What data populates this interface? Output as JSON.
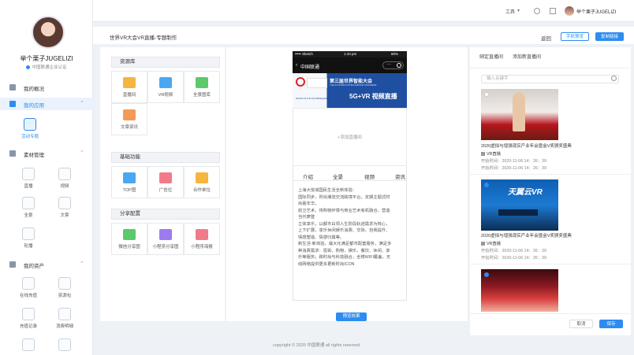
{
  "topbar": {
    "tools_label": "工具",
    "user_name": "举个栗子JUGELIZI"
  },
  "sidebar": {
    "user_name": "举个栗子JUGELIZI",
    "cert": "中国联通企业认证",
    "nav": [
      {
        "label": "我的概况"
      },
      {
        "label": "我的应用"
      },
      {
        "label": "素材管理"
      },
      {
        "label": "我的资产"
      }
    ],
    "app_items": [
      {
        "label": "活动专题"
      }
    ],
    "material_items": [
      {
        "label": "直播"
      },
      {
        "label": "视频"
      },
      {
        "label": "全景"
      },
      {
        "label": "文章"
      },
      {
        "label": "轮播"
      }
    ],
    "asset_items": [
      {
        "label": "在线充值"
      },
      {
        "label": "资源包"
      },
      {
        "label": "充值记录"
      },
      {
        "label": "消费明细"
      }
    ]
  },
  "header": {
    "title": "世界VR大会VR直播-专题制作",
    "back": "返回",
    "phone_preview": "手机预览",
    "copy_link": "复制链接"
  },
  "components": {
    "resource_title": "资源库",
    "resource_items": [
      {
        "label": "直播间"
      },
      {
        "label": "VR视频"
      },
      {
        "label": "全景图库"
      },
      {
        "label": "文章资讯"
      }
    ],
    "basic_title": "基础功能",
    "basic_items": [
      {
        "label": "TOP图"
      },
      {
        "label": "广告位"
      },
      {
        "label": "合作单位"
      }
    ],
    "share_title": "分享配置",
    "share_items": [
      {
        "label": "微信分享图"
      },
      {
        "label": "小程序分享图"
      },
      {
        "label": "小程序海报"
      }
    ]
  },
  "phone": {
    "status_left": "••••• Sketch",
    "status_time": "1:43 pm",
    "status_right": "80%",
    "nav_title": "中国联通",
    "banner_title": "第三届世界智能大会",
    "banner_sub": "THE 3rd WORLD INTELLIGENCE CONGRESS",
    "banner_big": "5G+VR 视频直播",
    "banner_date": "2019.5.16 9:16 16:00/May2019",
    "upload_text": "+添加直播间",
    "tabs": [
      "介绍",
      "全景",
      "视频",
      "资讯"
    ],
    "intro_lines": [
      "上海大悦城国民生活全新体验：",
      "国际同步，时尚潮流交流跨境平台，定期主题式时",
      "尚嘉年华。",
      "前卫艺术，将购物环境与商业艺术有机融合，营造",
      "当代摩登",
      "立体享乐，以都市白领人生阶段轨迹需求为核心，",
      "上下扩展，享乐休闲娱乐消费、交际、自我提升、",
      "情感塑造、情感归属等。",
      "新生活·新体验，最大化满足都市配套服务，满足多",
      "种消费需求：逛街、购物、娱乐、餐饮、休闲、享",
      "乐等服务；跨时尚与科技融合，全楼WIFI覆盖，无",
      "线网络提供更多更新时尚ICON"
    ],
    "preview_btn": "预览效果"
  },
  "right": {
    "tab_bound": "绑定直播间",
    "tab_add": "添加新直播间",
    "search_placeholder": "输入关键字",
    "cards": [
      {
        "title": "2020虚拟与增强现实产业年会暨金V奖颁奖盛典",
        "type": "VR直播",
        "time": "开始时间：2020-11-06 14：26：39"
      },
      {
        "title": "2020虚拟与增强现实产业年会暨金V奖颁奖盛典",
        "type": "VR直播",
        "time": "开始时间：2020-11-06 14：26：39"
      },
      {
        "title": "",
        "type": "",
        "time": ""
      }
    ],
    "cancel": "取消",
    "save": "保存"
  },
  "footer": {
    "copyright": "copyright © 2020 中国联通 all rights reserved."
  },
  "colors": {
    "accent": "#2d8cf0",
    "bg": "#eef1f5"
  }
}
